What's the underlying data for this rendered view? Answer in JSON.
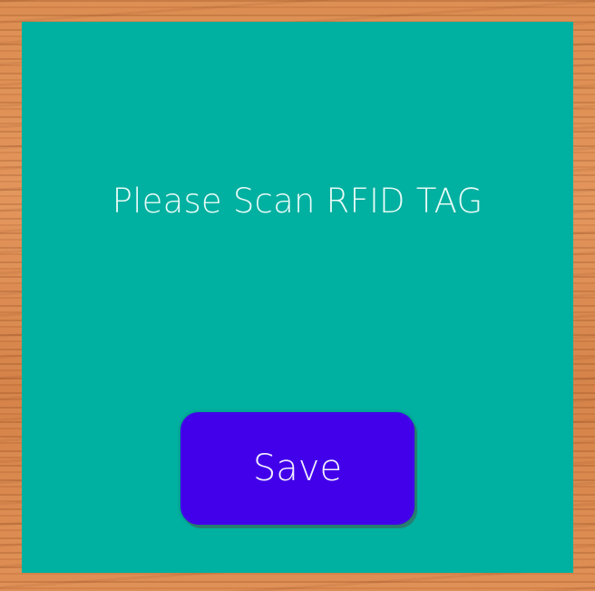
{
  "screen": {
    "prompt_text": "Please Scan RFID TAG"
  },
  "actions": {
    "save_label": "Save"
  },
  "colors": {
    "panel_background": "#00b0a0",
    "button_background": "#4200ea",
    "text_color": "#e8fbf8"
  }
}
